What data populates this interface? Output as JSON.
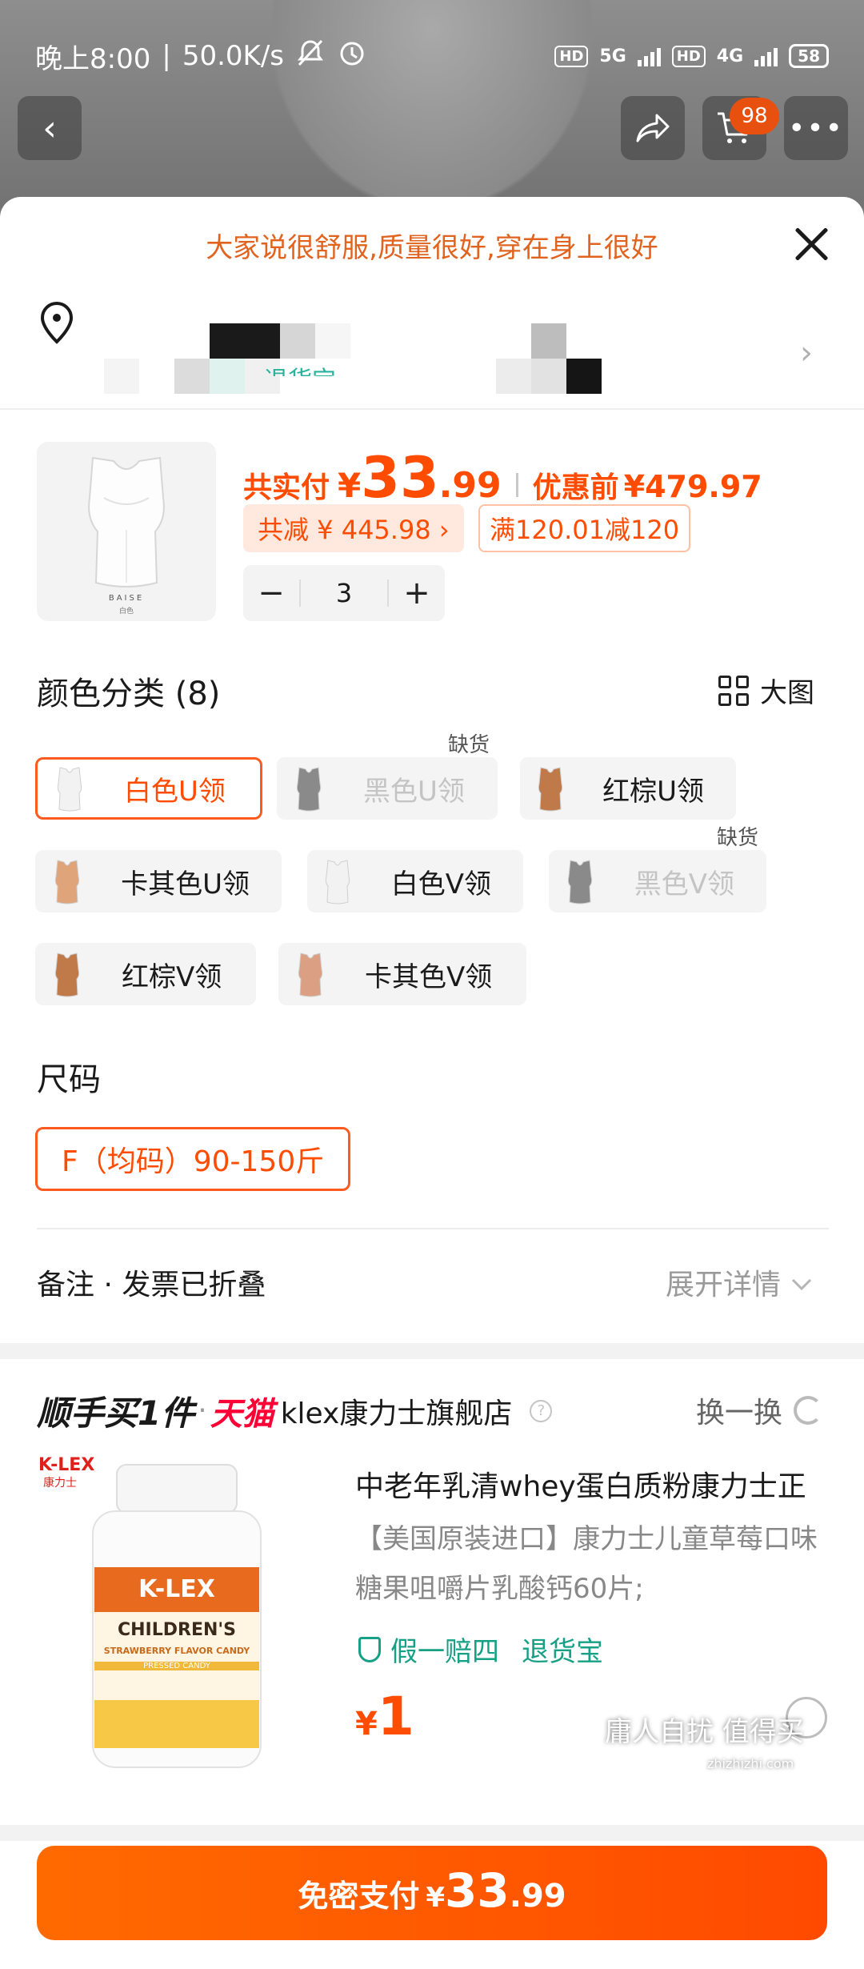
{
  "status_bar": {
    "time": "晚上8:00",
    "speed": "50.0K/s",
    "net1": "5G",
    "net2": "4G",
    "hd": "HD",
    "battery": "58"
  },
  "header": {
    "back_icon": "chevron-left-icon",
    "share_icon": "share-icon",
    "cart_icon": "cart-icon",
    "cart_badge": "98",
    "more_icon": "more-icon"
  },
  "sheet": {
    "promo_text": "大家说很舒服,质量很好,穿在身上很好",
    "address_hint": "退货宝"
  },
  "product": {
    "pay_label": "共实付",
    "yen": "¥",
    "pay_int": "33",
    "pay_dec": ".99",
    "pre_label": "优惠前",
    "pre_price": "¥479.97",
    "discount_chip": "共减 ¥ 445.98 ›",
    "coupon_chip": "满120.01减120",
    "qty": "3",
    "minus": "−",
    "plus": "+",
    "thumb_brand": "BAISE",
    "thumb_color": "白色"
  },
  "color_section": {
    "title": "颜色分类 (8)",
    "bigpic_label": "大图",
    "out_of_stock": "缺货",
    "options": [
      {
        "label": "白色U领",
        "state": "selected",
        "swatch": "#f2f2f2"
      },
      {
        "label": "黑色U领",
        "state": "disabled",
        "swatch": "#8a8a8a"
      },
      {
        "label": "红棕U领",
        "state": "normal",
        "swatch": "#c07a4a"
      },
      {
        "label": "卡其色U领",
        "state": "normal",
        "swatch": "#e0a47a"
      },
      {
        "label": "白色V领",
        "state": "normal",
        "swatch": "#f2f2f2"
      },
      {
        "label": "黑色V领",
        "state": "disabled",
        "swatch": "#8a8a8a"
      },
      {
        "label": "红棕V领",
        "state": "normal",
        "swatch": "#c07a4a"
      },
      {
        "label": "卡其色V领",
        "state": "normal",
        "swatch": "#dba083"
      }
    ]
  },
  "size_section": {
    "title": "尺码",
    "option": "F（均码）90-150斤"
  },
  "remark": {
    "label": "备注 · 发票已折叠",
    "expand": "展开详情"
  },
  "addon": {
    "shunshou": "顺手买1件",
    "dot": "·",
    "tmall": "天猫",
    "store": "klex康力士旗舰店",
    "swap": "换一换",
    "name": "中老年乳清whey蛋白质粉康力士正",
    "desc": "【美国原装进口】康力士儿童草莓口味糖果咀嚼片乳酸钙60片;",
    "guarantee1": "假一赔四",
    "guarantee2": "退货宝",
    "price_yen": "¥",
    "price": "1",
    "bottle_logo": "K-LEX",
    "bottle_logo2": "K-LEX",
    "bottle_logo_cn": "康力士",
    "bottle_line1": "CHILDREN'S",
    "bottle_line2": "STRAWBERRY FLAVOR CANDY",
    "bottle_line3": "PRESSED CANDY"
  },
  "pay_button": {
    "label": "免密支付",
    "yen": "¥",
    "int": "33",
    "dec": ".99"
  },
  "watermark": {
    "text": "庸人自扰 值得买",
    "url": "zhizhizhi.com"
  },
  "colors": {
    "accent": "#ff4c00",
    "tmall_red": "#ff0036",
    "teal": "#16a085"
  }
}
